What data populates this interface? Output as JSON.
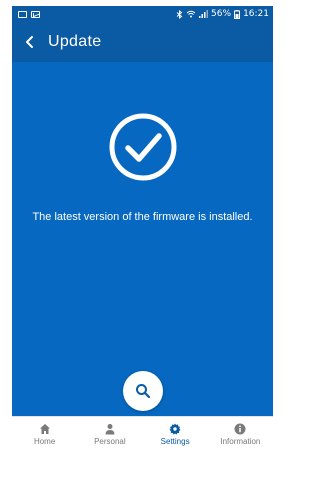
{
  "status_bar": {
    "icons_left": [
      "sim-icon",
      "mail-icon"
    ],
    "bluetooth_icon": "bluetooth-icon",
    "wifi_icon": "wifi-icon",
    "signal_icon": "signal-icon",
    "battery_percent": "56%",
    "battery_icon": "battery-icon",
    "time": "16:21"
  },
  "app_bar": {
    "back_icon": "chevron-left-icon",
    "title": "Update"
  },
  "main": {
    "status_icon": "check-circle-icon",
    "message": "The latest version of the firmware is installed.",
    "fab_icon": "search-icon"
  },
  "bottom_nav": {
    "items": [
      {
        "label": "Home",
        "icon": "home-icon",
        "active": false
      },
      {
        "label": "Personal",
        "icon": "person-icon",
        "active": false
      },
      {
        "label": "Settings",
        "icon": "gear-icon",
        "active": true
      },
      {
        "label": "Information",
        "icon": "info-icon",
        "active": false
      }
    ]
  },
  "colors": {
    "app_bar": "#0a5aa4",
    "content": "#0668c0",
    "active_tab": "#0a5aa4",
    "inactive_tab": "#7a7a7a"
  }
}
